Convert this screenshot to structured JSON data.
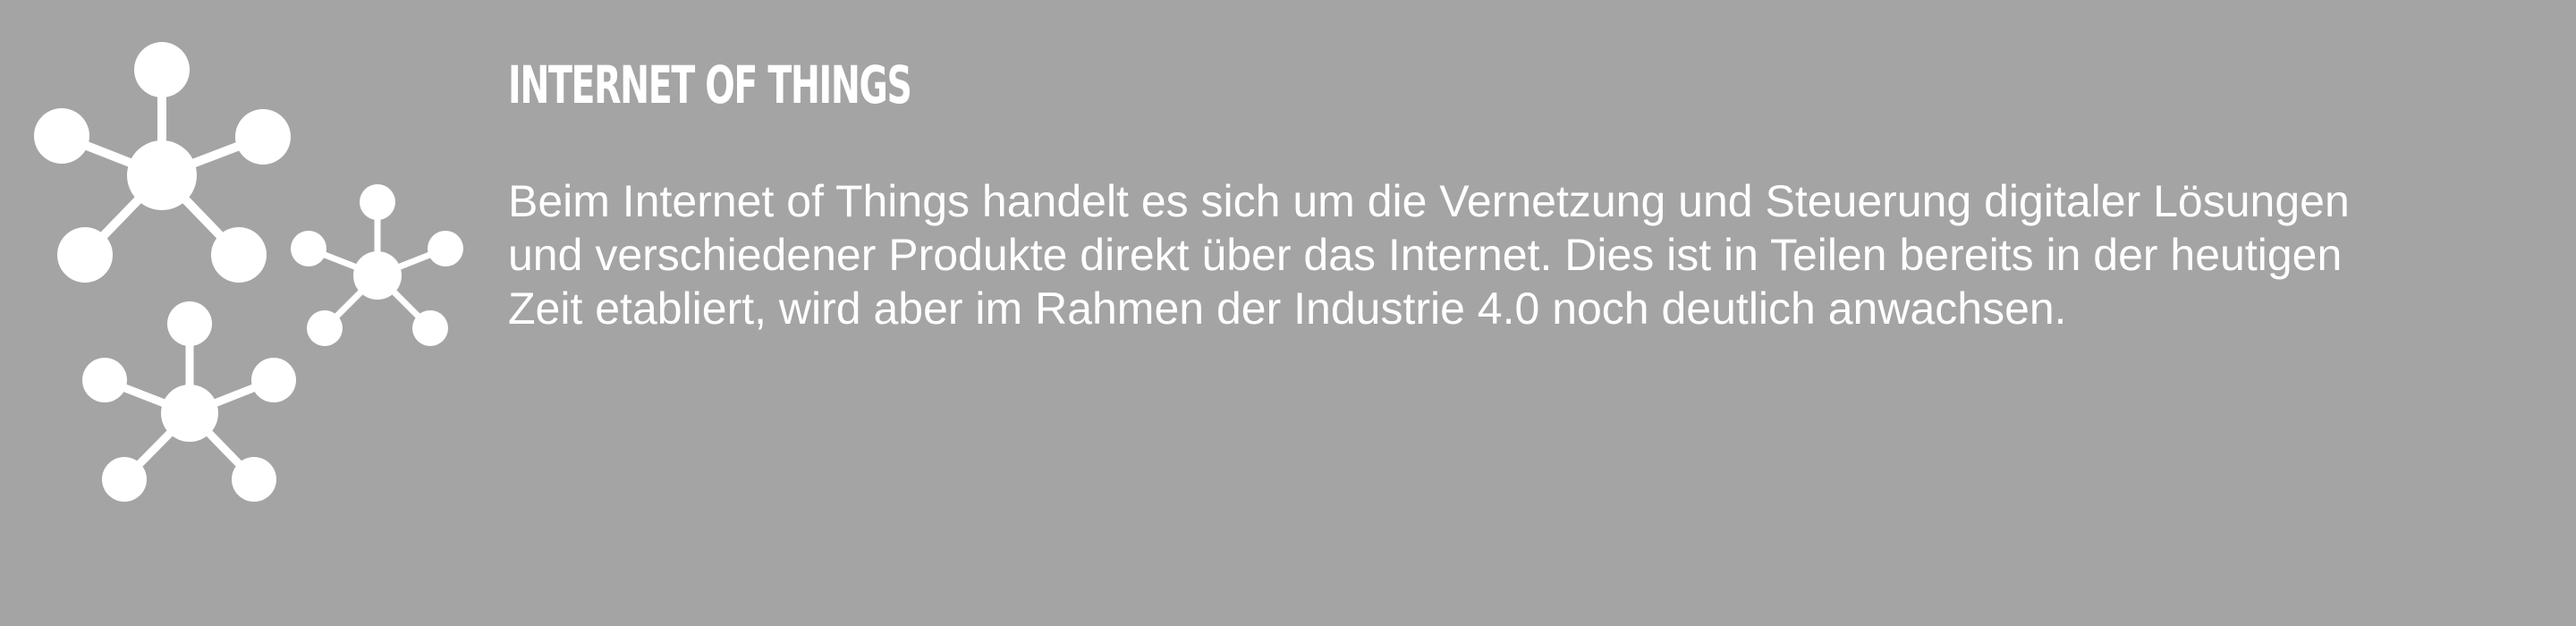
{
  "banner": {
    "title": "INTERNET OF THINGS",
    "description": "Beim Internet of Things handelt es sich um die Vernetzung und Steuerung digitaler Lösungen und verschiedener Produkte direkt über das Internet. Dies ist in Teilen bereits in der heutigen Zeit etabliert, wird aber im Rahmen der Industrie 4.0 noch deutlich anwachsen.",
    "icon": "network-nodes-icon",
    "colors": {
      "background": "#a4a4a4",
      "foreground": "#ffffff"
    }
  }
}
